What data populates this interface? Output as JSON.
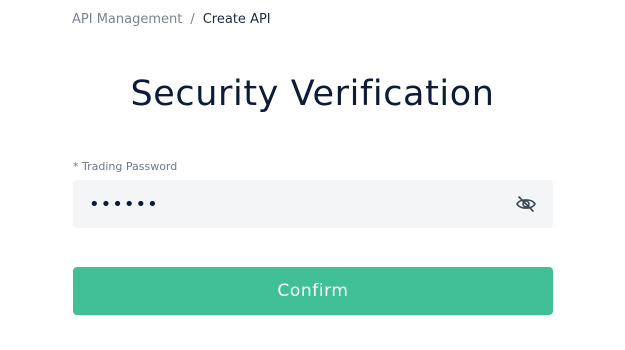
{
  "breadcrumb": {
    "parent": "API Management",
    "separator": "/",
    "current": "Create API"
  },
  "page": {
    "title": "Security Verification"
  },
  "form": {
    "password_label": "* Trading Password",
    "password_value": "••••••",
    "password_visibility_icon": "eye-slash-icon",
    "confirm_label": "Confirm"
  },
  "colors": {
    "accent": "#41bf97",
    "input_bg": "#f4f5f7",
    "title": "#0e1b36"
  }
}
